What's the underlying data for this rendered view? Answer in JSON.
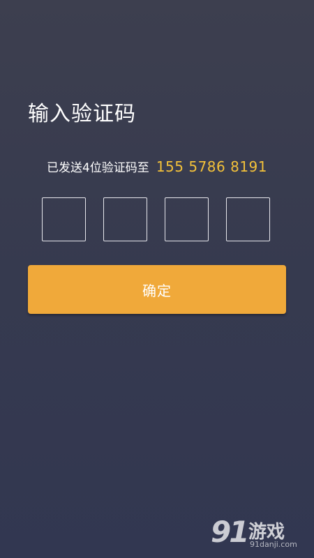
{
  "page": {
    "title": "输入验证码"
  },
  "sent_message": {
    "prefix": "已发送4位验证码至",
    "phone": "155 5786 8191"
  },
  "code_inputs": [
    {
      "value": ""
    },
    {
      "value": ""
    },
    {
      "value": ""
    },
    {
      "value": ""
    }
  ],
  "confirm_button": {
    "label": "确定"
  },
  "watermark": {
    "number": "91",
    "brand": "游戏",
    "site": "91danji.com"
  },
  "colors": {
    "background_top": "#3d3f4f",
    "background_bottom": "#323751",
    "accent": "#f0a93a",
    "phone_text": "#f3c13a"
  }
}
